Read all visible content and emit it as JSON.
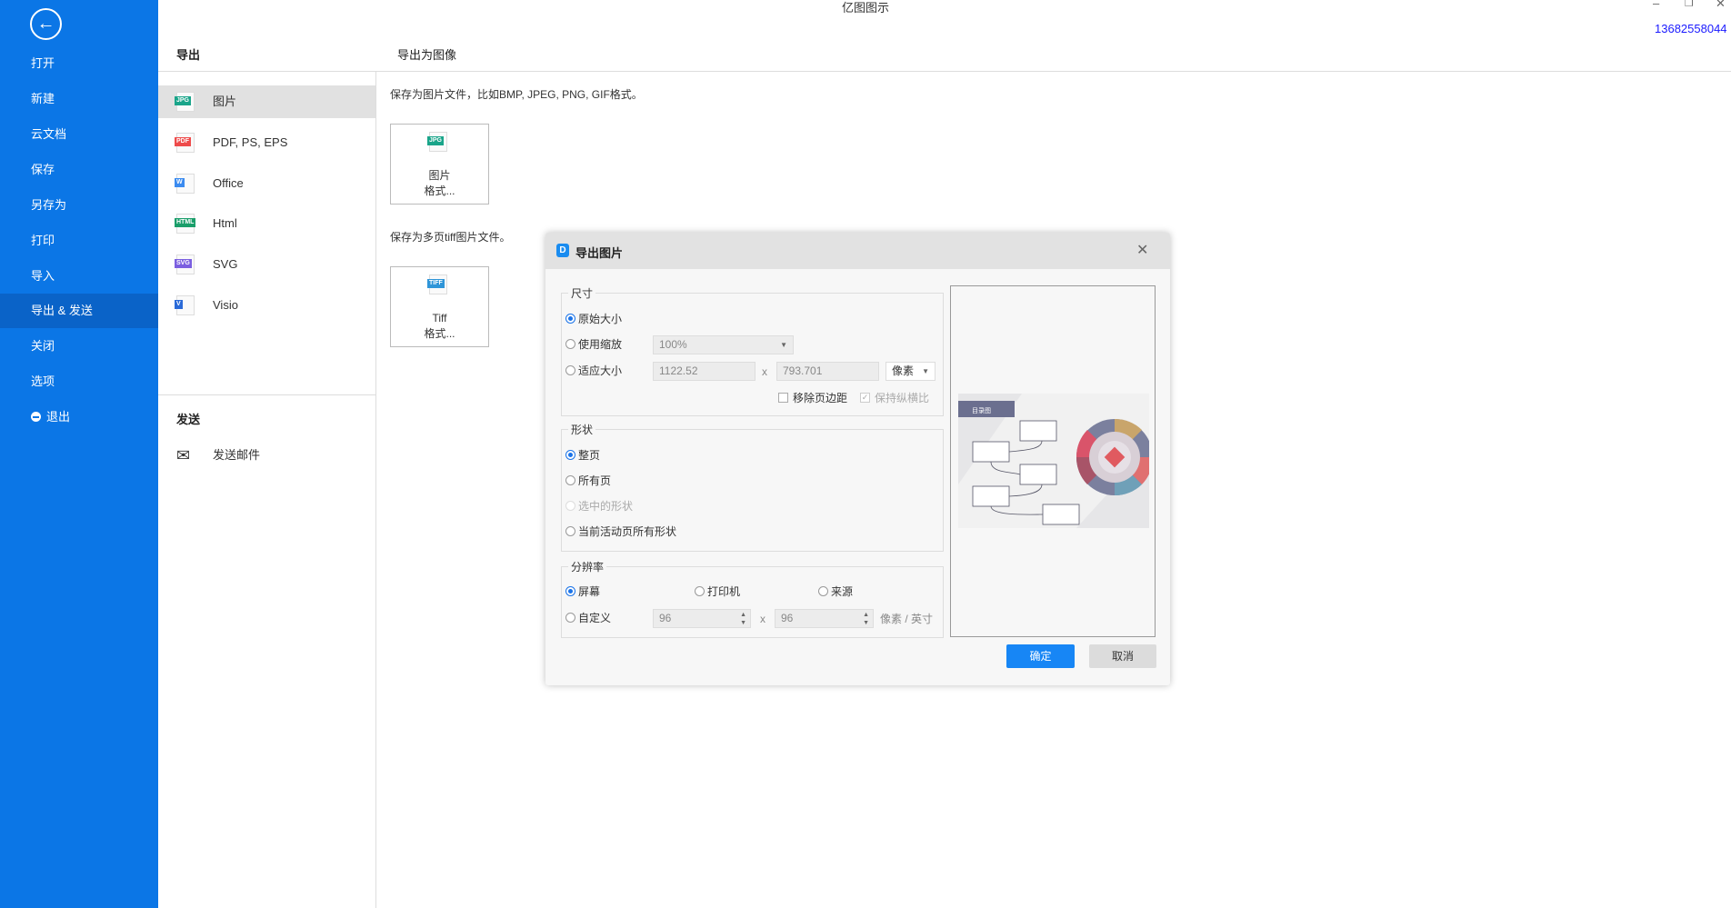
{
  "app": {
    "title": "亿图图示",
    "phone": "13682558044",
    "window": {
      "minimize_icon": "minimize",
      "restore_icon": "restore",
      "close_icon": "close"
    }
  },
  "sidebar": {
    "back_icon": "arrow-left-circle",
    "items": [
      {
        "label": "打开"
      },
      {
        "label": "新建"
      },
      {
        "label": "云文档"
      },
      {
        "label": "保存"
      },
      {
        "label": "另存为"
      },
      {
        "label": "打印"
      },
      {
        "label": "导入"
      },
      {
        "label": "导出 & 发送",
        "active": true
      },
      {
        "label": "关闭"
      },
      {
        "label": "选项"
      },
      {
        "label": "退出",
        "icon": "minus-circle"
      }
    ]
  },
  "export_panel": {
    "header": "导出",
    "items": [
      {
        "label": "图片",
        "badge": "JPG",
        "color": "#1aa58a",
        "selected": true
      },
      {
        "label": "PDF, PS, EPS",
        "badge": "PDF",
        "color": "#ee4b4b"
      },
      {
        "label": "Office",
        "badge": "W",
        "color": "#3b8bf0"
      },
      {
        "label": "Html",
        "badge": "HTML",
        "color": "#1a9e6a"
      },
      {
        "label": "SVG",
        "badge": "SVG",
        "color": "#7b5fe0"
      },
      {
        "label": "Visio",
        "badge": "V",
        "color": "#2a6ad8"
      }
    ],
    "send_header": "发送",
    "send_items": [
      {
        "label": "发送邮件",
        "icon": "mail-send"
      }
    ]
  },
  "content": {
    "header": "导出为图像",
    "image_desc": "保存为图片文件，比如BMP, JPEG, PNG, GIF格式。",
    "image_card": {
      "badge": "JPG",
      "line1": "图片",
      "line2": "格式..."
    },
    "tiff_desc": "保存为多页tiff图片文件。",
    "tiff_card": {
      "badge": "TIFF",
      "line1": "Tiff",
      "line2": "格式..."
    }
  },
  "dialog": {
    "title": "导出图片",
    "close_icon": "close",
    "size": {
      "legend": "尺寸",
      "original": "原始大小",
      "use_zoom": "使用缩放",
      "zoom_value": "100%",
      "fit": "适应大小",
      "width": "1122.52",
      "x": "x",
      "height": "793.701",
      "unit": "像素",
      "remove_margin": "移除页边距",
      "keep_ratio": "保持纵横比",
      "selected": "original"
    },
    "shape": {
      "legend": "形状",
      "whole_page": "整页",
      "all_pages": "所有页",
      "selected_shapes": "选中的形状",
      "current_page_all": "当前活动页所有形状",
      "selected": "whole_page"
    },
    "resolution": {
      "legend": "分辨率",
      "screen": "屏幕",
      "printer": "打印机",
      "source": "来源",
      "custom": "自定义",
      "dpi_x": "96",
      "x": "x",
      "dpi_y": "96",
      "unit": "像素 / 英寸",
      "selected": "screen"
    },
    "preview": {
      "banner": "目录图"
    },
    "ok": "确定",
    "cancel": "取消",
    "accent": "#1a73e8"
  }
}
